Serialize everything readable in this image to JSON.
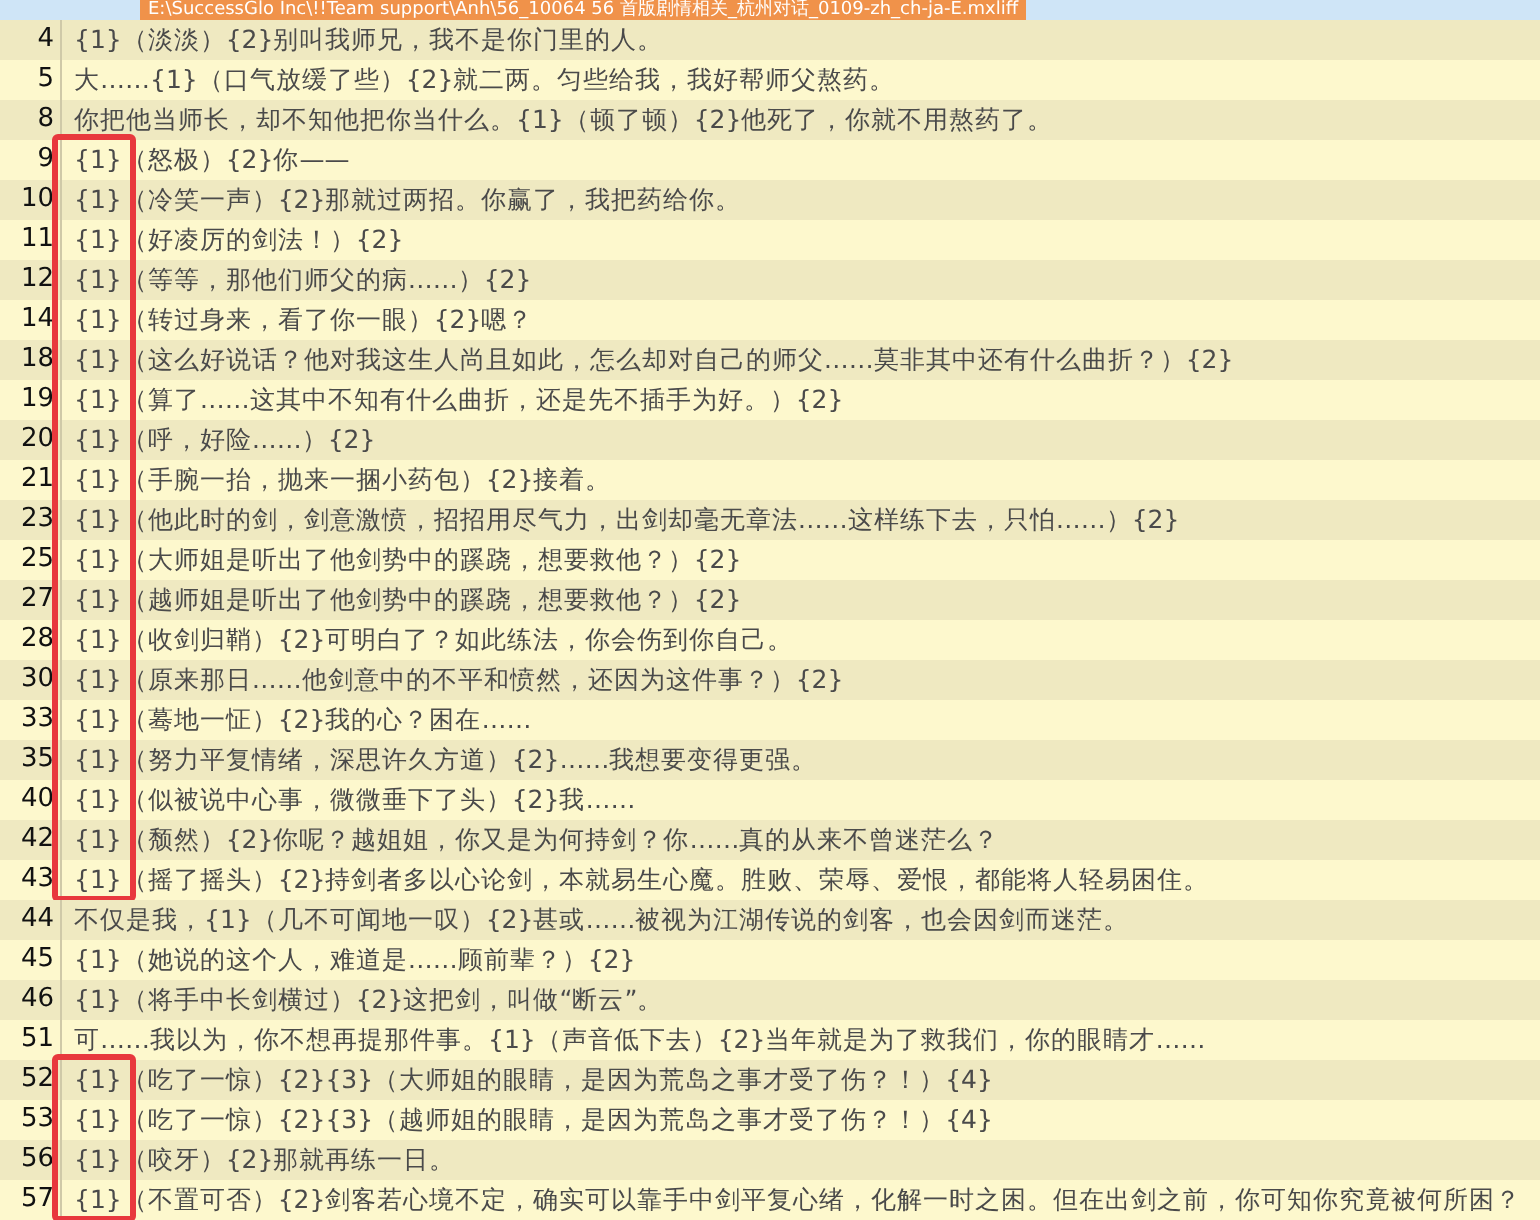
{
  "file_tab": {
    "path": "E:\\SuccessGlo Inc\\!!Team support\\Anh\\56_10064 56 首版剧情相关_杭州对话_0109-zh_ch-ja-E.mxliff"
  },
  "rows": [
    {
      "number": "4",
      "text": "{1}（淡淡）{2}别叫我师兄，我不是你门里的人。",
      "boxed": false
    },
    {
      "number": "5",
      "text": "大……{1}（口气放缓了些）{2}就二两。匀些给我，我好帮师父熬药。",
      "boxed": false
    },
    {
      "number": "8",
      "text": "你把他当师长，却不知他把你当什么。{1}（顿了顿）{2}他死了，你就不用熬药了。",
      "boxed": false
    },
    {
      "number": "9",
      "text": "{1}（怒极）{2}你——",
      "boxed": true
    },
    {
      "number": "10",
      "text": "{1}（冷笑一声）{2}那就过两招。你赢了，我把药给你。",
      "boxed": true
    },
    {
      "number": "11",
      "text": "{1}（好凌厉的剑法！）{2}",
      "boxed": true
    },
    {
      "number": "12",
      "text": "{1}（等等，那他们师父的病……）{2}",
      "boxed": true
    },
    {
      "number": "14",
      "text": "{1}（转过身来，看了你一眼）{2}嗯？",
      "boxed": true
    },
    {
      "number": "18",
      "text": "{1}（这么好说话？他对我这生人尚且如此，怎么却对自己的师父……莫非其中还有什么曲折？）{2}",
      "boxed": true
    },
    {
      "number": "19",
      "text": "{1}（算了……这其中不知有什么曲折，还是先不插手为好。）{2}",
      "boxed": true
    },
    {
      "number": "20",
      "text": "{1}（呼，好险……）{2}",
      "boxed": true
    },
    {
      "number": "21",
      "text": "{1}（手腕一抬，抛来一捆小药包）{2}接着。",
      "boxed": true
    },
    {
      "number": "23",
      "text": "{1}（他此时的剑，剑意激愤，招招用尽气力，出剑却毫无章法……这样练下去，只怕……）{2}",
      "boxed": true
    },
    {
      "number": "25",
      "text": "{1}（大师姐是听出了他剑势中的蹊跷，想要救他？）{2}",
      "boxed": true
    },
    {
      "number": "27",
      "text": "{1}（越师姐是听出了他剑势中的蹊跷，想要救他？）{2}",
      "boxed": true
    },
    {
      "number": "28",
      "text": "{1}（收剑归鞘）{2}可明白了？如此练法，你会伤到你自己。",
      "boxed": true
    },
    {
      "number": "30",
      "text": "{1}（原来那日……他剑意中的不平和愤然，还因为这件事？）{2}",
      "boxed": true
    },
    {
      "number": "33",
      "text": "{1}（蓦地一怔）{2}我的心？困在……",
      "boxed": true
    },
    {
      "number": "35",
      "text": "{1}（努力平复情绪，深思许久方道）{2}……我想要变得更强。",
      "boxed": true
    },
    {
      "number": "40",
      "text": "{1}（似被说中心事，微微垂下了头）{2}我……",
      "boxed": true
    },
    {
      "number": "42",
      "text": "{1}（颓然）{2}你呢？越姐姐，你又是为何持剑？你……真的从来不曾迷茫么？",
      "boxed": true
    },
    {
      "number": "43",
      "text": "{1}（摇了摇头）{2}持剑者多以心论剑，本就易生心魔。胜败、荣辱、爱恨，都能将人轻易困住。",
      "boxed": true
    },
    {
      "number": "44",
      "text": "不仅是我，{1}（几不可闻地一叹）{2}甚或……被视为江湖传说的剑客，也会因剑而迷茫。",
      "boxed": false
    },
    {
      "number": "45",
      "text": "{1}（她说的这个人，难道是……顾前辈？）{2}",
      "boxed": false
    },
    {
      "number": "46",
      "text": "{1}（将手中长剑横过）{2}这把剑，叫做“断云”。",
      "boxed": false
    },
    {
      "number": "51",
      "text": "可……我以为，你不想再提那件事。{1}（声音低下去）{2}当年就是为了救我们，你的眼睛才……",
      "boxed": false
    },
    {
      "number": "52",
      "text": "{1}（吃了一惊）{2}{3}（大师姐的眼睛，是因为荒岛之事才受了伤？！）{4}",
      "boxed": true
    },
    {
      "number": "53",
      "text": "{1}（吃了一惊）{2}{3}（越师姐的眼睛，是因为荒岛之事才受了伤？！）{4}",
      "boxed": true
    },
    {
      "number": "56",
      "text": "{1}（咬牙）{2}那就再练一日。",
      "boxed": true
    },
    {
      "number": "57",
      "text": "{1}（不置可否）{2}剑客若心境不定，确实可以靠手中剑平复心绪，化解一时之困。但在出剑之前，你可知你究竟被何所困？",
      "boxed": true
    }
  ]
}
